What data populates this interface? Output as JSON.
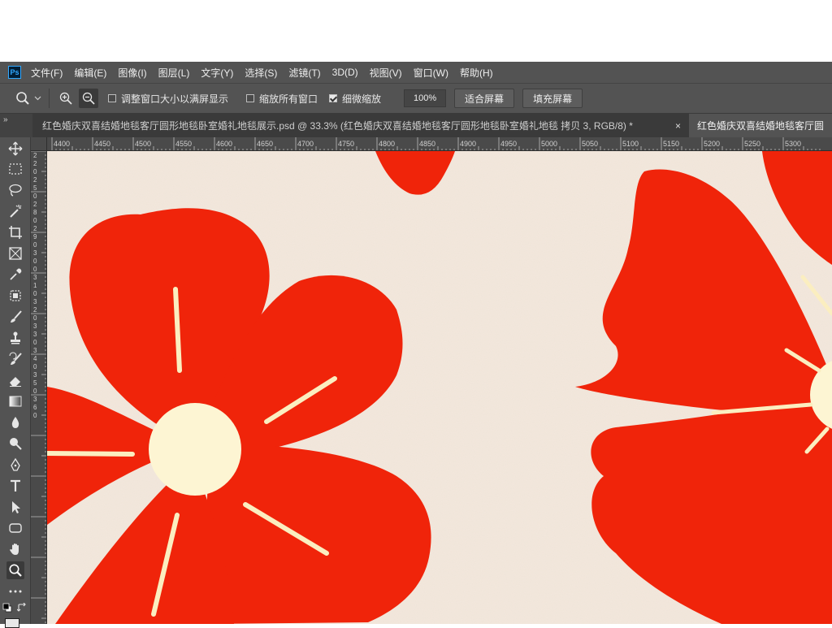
{
  "menubar": {
    "app_badge": "Ps",
    "items": [
      "文件(F)",
      "编辑(E)",
      "图像(I)",
      "图层(L)",
      "文字(Y)",
      "选择(S)",
      "滤镜(T)",
      "3D(D)",
      "视图(V)",
      "窗口(W)",
      "帮助(H)"
    ]
  },
  "options": {
    "resize_windows": "调整窗口大小以满屏显示",
    "zoom_all": "缩放所有窗口",
    "scrubby_zoom": "细微缩放",
    "zoom_value": "100%",
    "fit_screen": "适合屏幕",
    "fill_screen": "填充屏幕",
    "resize_windows_checked": false,
    "zoom_all_checked": false,
    "scrubby_zoom_checked": true
  },
  "tabs": {
    "collapse": "»",
    "tab1": "红色婚庆双喜结婚地毯客厅圆形地毯卧室婚礼地毯展示.psd @ 33.3% (红色婚庆双喜结婚地毯客厅圆形地毯卧室婚礼地毯 拷贝 3, RGB/8) *",
    "tab1_close": "×",
    "tab2": "红色婚庆双喜结婚地毯客厅圆"
  },
  "ruler": {
    "top_labels": [
      "4400",
      "4450",
      "4500",
      "4550",
      "4600",
      "4650",
      "4700",
      "4750",
      "4800",
      "4850",
      "4900",
      "4950",
      "5000",
      "5050",
      "5100",
      "5150",
      "5200",
      "5250",
      "5300"
    ],
    "left_labels": [
      "2",
      "2",
      "0",
      "2",
      "5",
      "0",
      "2",
      "8",
      "0",
      "2",
      "9",
      "0",
      "3",
      "0",
      "0",
      "3",
      "1",
      "0",
      "3",
      "2",
      "0",
      "3",
      "3",
      "0",
      "3",
      "4",
      "0",
      "3",
      "5",
      "0",
      "3",
      "6",
      "0"
    ]
  },
  "colors": {
    "petal_red": "#f0240a",
    "flower_center": "#fdf5d3",
    "stamen": "#fbeec0",
    "canvas_bg": "#f3e8dd"
  },
  "tools": [
    "move-icon",
    "marquee-icon",
    "lasso-icon",
    "magic-wand-icon",
    "crop-icon",
    "frame-icon",
    "eyedropper-icon",
    "patch-icon",
    "brush-icon",
    "stamp-icon",
    "history-brush-icon",
    "eraser-icon",
    "gradient-icon",
    "blur-icon",
    "dodge-icon",
    "pen-icon",
    "type-icon",
    "path-select-icon",
    "shape-icon",
    "hand-icon",
    "zoom-icon",
    "more-tools-icon",
    "default-colors-icon",
    "swap-colors-icon"
  ]
}
